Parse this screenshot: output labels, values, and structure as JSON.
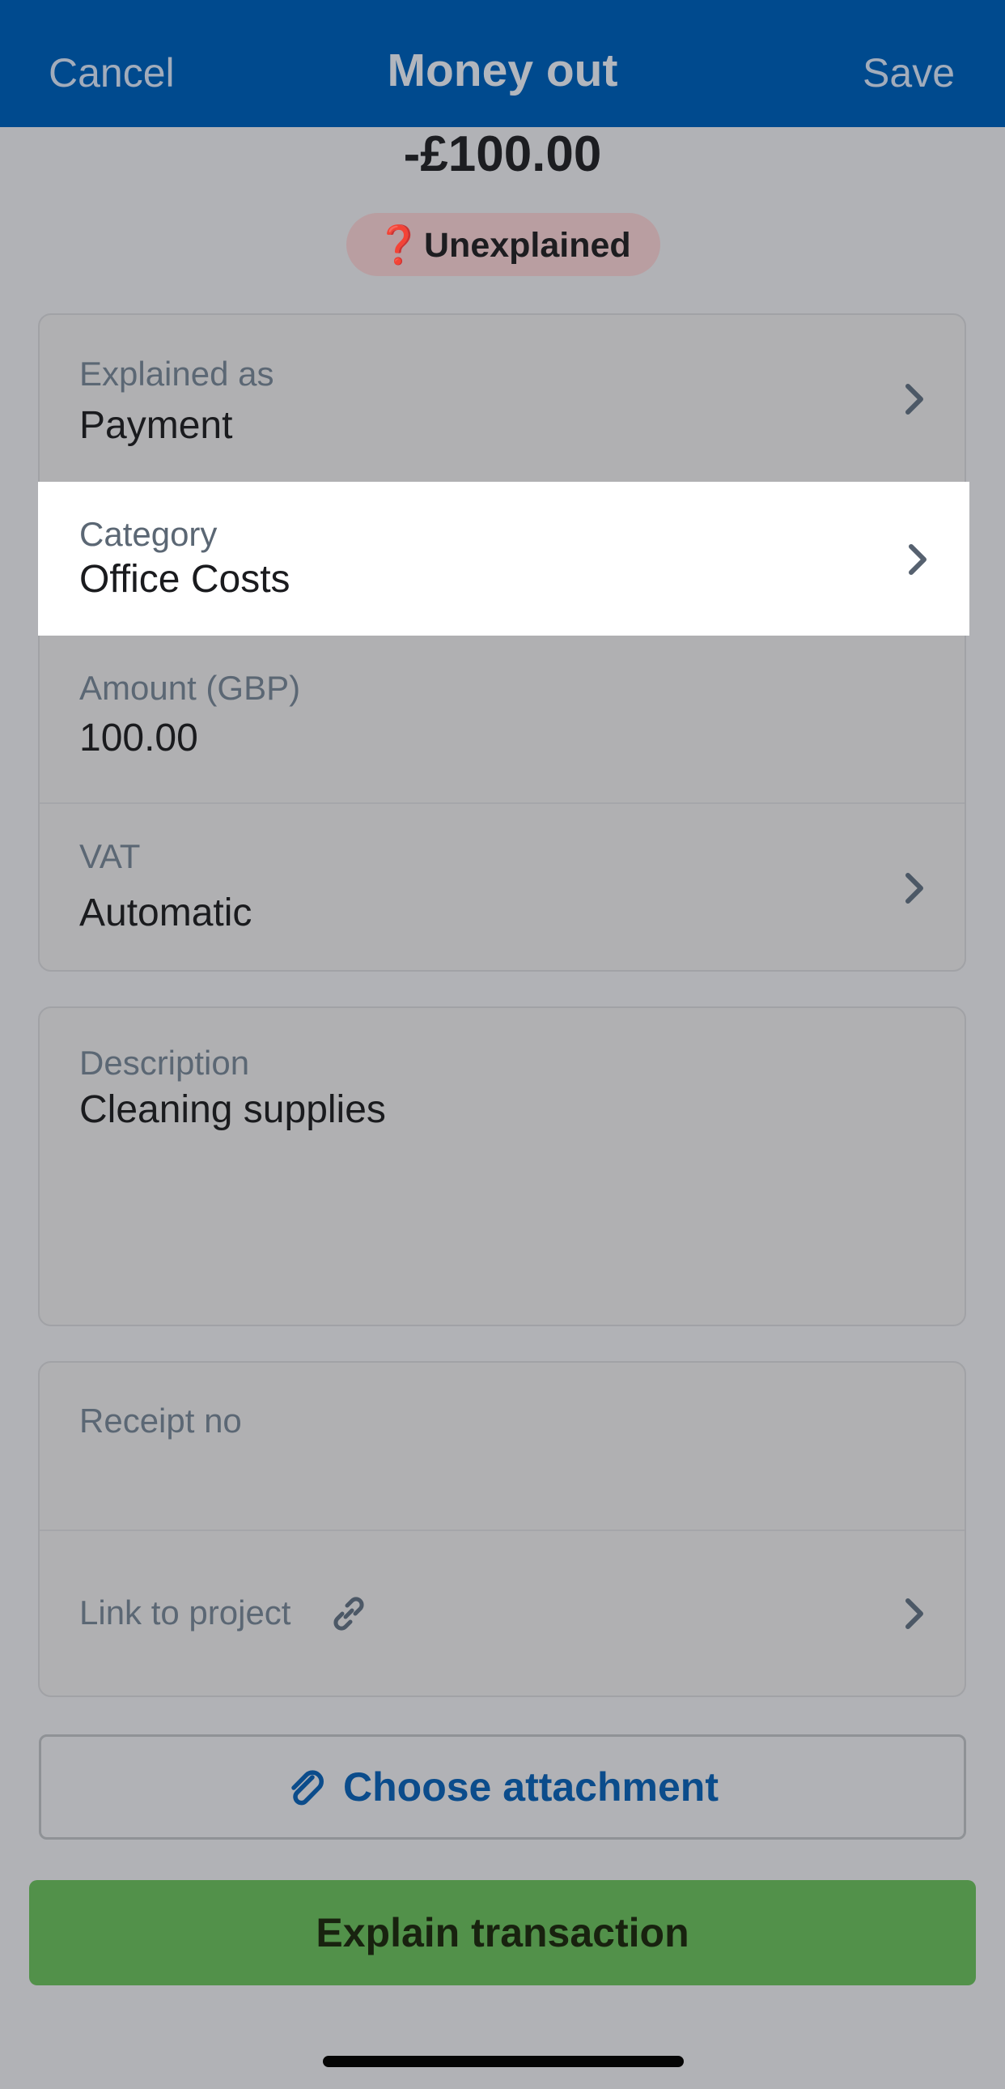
{
  "header": {
    "cancel_label": "Cancel",
    "title": "Money out",
    "save_label": "Save"
  },
  "transaction": {
    "amount": "-£100.00",
    "status_icon": "❓",
    "status_label": "Unexplained"
  },
  "details": {
    "explained_as": {
      "label": "Explained as",
      "value": "Payment"
    },
    "category": {
      "label": "Category",
      "value": "Office Costs"
    },
    "amount": {
      "label": "Amount (GBP)",
      "value": "100.00"
    },
    "vat": {
      "label": "VAT",
      "value": "Automatic"
    }
  },
  "description": {
    "label": "Description",
    "value": "Cleaning supplies"
  },
  "extra": {
    "receipt_label": "Receipt no",
    "receipt_value": "",
    "link_project_label": "Link to project"
  },
  "buttons": {
    "attachment_label": "Choose attachment",
    "explain_label": "Explain transaction"
  },
  "icons": {
    "status": "question-mark-icon",
    "chevron": "chevron-right-icon",
    "link": "link-icon",
    "attachment": "paperclip-icon"
  },
  "colors": {
    "header_bg": "#004a8e",
    "accent_blue": "#0b4c8b",
    "primary_green": "#52914a",
    "badge_bg": "#b99ea1",
    "badge_icon": "#b1283a",
    "overlay": "#b1b2b6"
  }
}
